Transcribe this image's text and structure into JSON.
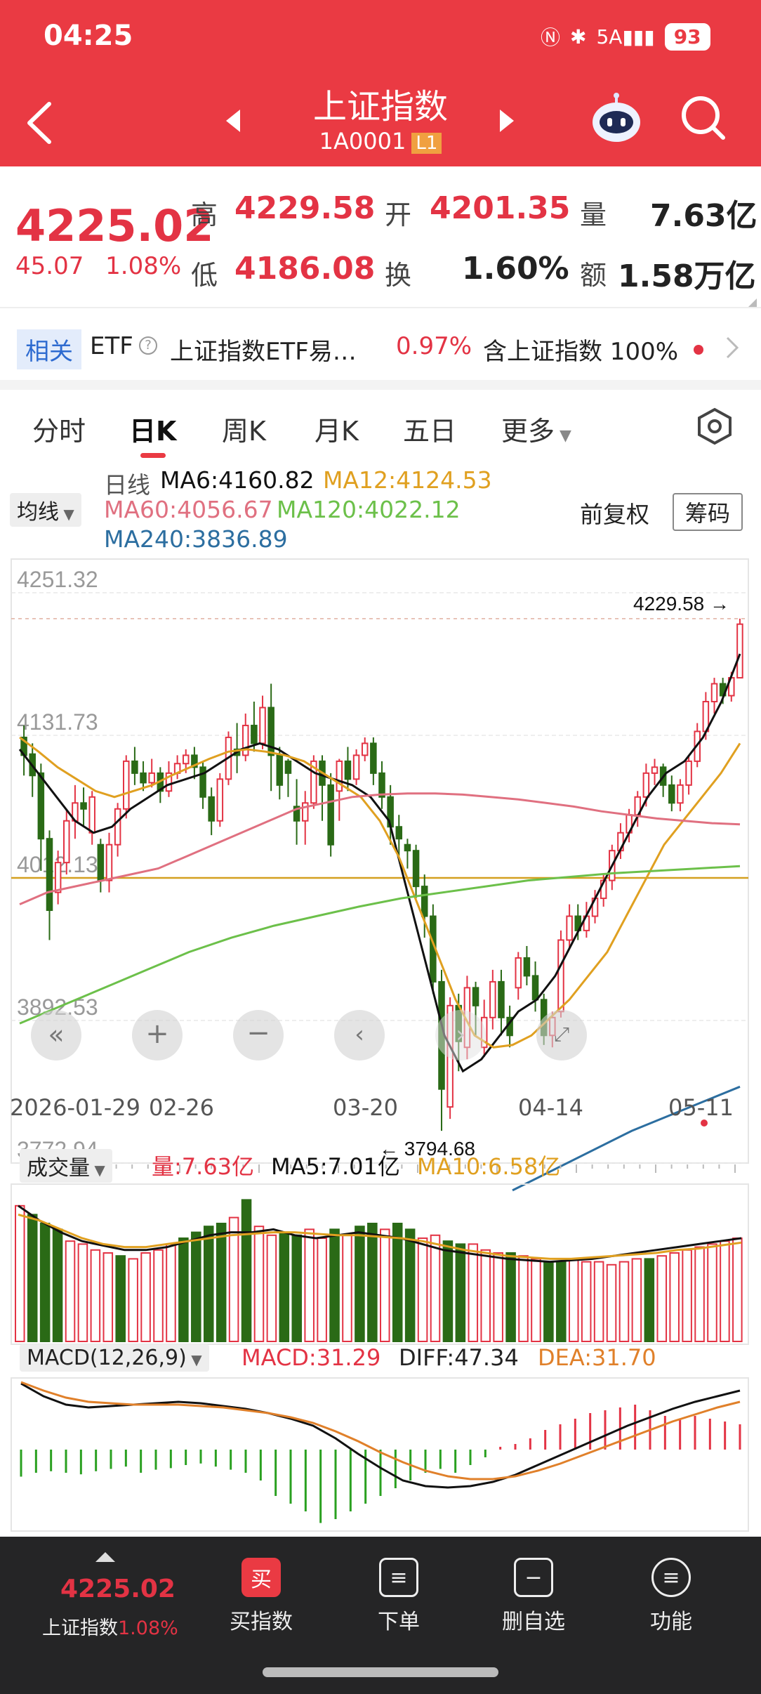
{
  "status": {
    "time": "04:25",
    "signal": "5A",
    "battery": "93"
  },
  "header": {
    "title": "上证指数",
    "code": "1A0001",
    "level": "L1"
  },
  "quote": {
    "price": "4225.02",
    "change": "45.07",
    "change_pct": "1.08%",
    "high_label": "高",
    "high": "4229.58",
    "open_label": "开",
    "open": "4201.35",
    "volume_label": "量",
    "volume": "7.63亿",
    "low_label": "低",
    "low": "4186.08",
    "turnover_label": "换",
    "turnover": "1.60%",
    "amount_label": "额",
    "amount": "1.58万亿"
  },
  "etf": {
    "tag": "相关",
    "label": "ETF",
    "name": "上证指数ETF易…",
    "pct": "0.97%",
    "holding": "含上证指数 100%"
  },
  "tabs": [
    "分时",
    "日K",
    "周K",
    "月K",
    "五日",
    "更多"
  ],
  "kline": {
    "ma_select": "均线",
    "period": "日线",
    "ma6": "MA6:4160.82",
    "ma12": "MA12:4124.53",
    "ma60": "MA60:4056.67",
    "ma120": "MA120:4022.12",
    "ma240": "MA240:3836.89",
    "adjust": "前复权",
    "chips": "筹码",
    "high_marker": "4229.58",
    "low_marker": "3794.68",
    "dates": [
      "2026-01-29",
      "02-26",
      "03-20",
      "04-14",
      "05-11"
    ],
    "colors": {
      "up": "#e33344",
      "down": "#2a6a16",
      "ma6": "#111111",
      "ma12": "#e0a020",
      "ma60": "#e07080",
      "ma120": "#6cc04a",
      "ma240": "#2c6ea0"
    }
  },
  "volume": {
    "select": "成交量",
    "vol": "量:7.63亿",
    "ma5": "MA5:7.01亿",
    "ma10": "MA10:6.58亿"
  },
  "macd": {
    "select": "MACD(12,26,9)",
    "macd": "MACD:31.29",
    "diff": "DIFF:47.34",
    "dea": "DEA:31.70"
  },
  "chart_data": {
    "type": "candlestick",
    "title": "上证指数 日K",
    "y_ticks": [
      4251.32,
      4131.73,
      4012.13,
      3892.53,
      3772.94
    ],
    "x_ticks": [
      "2026-01-29",
      "02-26",
      "03-20",
      "04-14",
      "05-11"
    ],
    "ylim": [
      3772.94,
      4251.32
    ],
    "candles": [
      [
        4130,
        4115,
        4140,
        4098
      ],
      [
        4116,
        4098,
        4125,
        4080
      ],
      [
        4100,
        4045,
        4108,
        4018
      ],
      [
        4045,
        3985,
        4052,
        3960
      ],
      [
        4000,
        4025,
        4035,
        3990
      ],
      [
        4025,
        4060,
        4070,
        4015
      ],
      [
        4060,
        4075,
        4090,
        4045
      ],
      [
        4075,
        4070,
        4088,
        4055
      ],
      [
        4050,
        4080,
        4085,
        4040
      ],
      [
        4040,
        4010,
        4045,
        4000
      ],
      [
        4010,
        4040,
        4050,
        4000
      ],
      [
        4040,
        4070,
        4075,
        4030
      ],
      [
        4070,
        4110,
        4115,
        4062
      ],
      [
        4110,
        4100,
        4122,
        4090
      ],
      [
        4100,
        4092,
        4110,
        4085
      ],
      [
        4092,
        4100,
        4112,
        4088
      ],
      [
        4100,
        4085,
        4105,
        4075
      ],
      [
        4085,
        4100,
        4110,
        4080
      ],
      [
        4100,
        4108,
        4115,
        4095
      ],
      [
        4108,
        4115,
        4120,
        4100
      ],
      [
        4115,
        4105,
        4122,
        4095
      ],
      [
        4105,
        4080,
        4110,
        4070
      ],
      [
        4080,
        4060,
        4088,
        4048
      ],
      [
        4060,
        4095,
        4100,
        4055
      ],
      [
        4095,
        4130,
        4135,
        4090
      ],
      [
        4120,
        4115,
        4142,
        4100
      ],
      [
        4115,
        4140,
        4150,
        4110
      ],
      [
        4140,
        4125,
        4160,
        4118
      ],
      [
        4125,
        4155,
        4165,
        4120
      ],
      [
        4155,
        4115,
        4175,
        4085
      ],
      [
        4115,
        4090,
        4122,
        4078
      ],
      [
        4110,
        4100,
        4112,
        4080
      ],
      [
        4072,
        4060,
        4095,
        4040
      ],
      [
        4060,
        4075,
        4085,
        4040
      ],
      [
        4075,
        4110,
        4115,
        4070
      ],
      [
        4110,
        4090,
        4115,
        4060
      ],
      [
        4090,
        4040,
        4100,
        4030
      ],
      [
        4085,
        4110,
        4112,
        4060
      ],
      [
        4110,
        4095,
        4122,
        4085
      ],
      [
        4095,
        4115,
        4120,
        4090
      ],
      [
        4115,
        4125,
        4130,
        4110
      ],
      [
        4125,
        4100,
        4130,
        4090
      ],
      [
        4100,
        4080,
        4110,
        4070
      ],
      [
        4080,
        4055,
        4090,
        4040
      ],
      [
        4055,
        4045,
        4065,
        4030
      ],
      [
        4040,
        4035,
        4045,
        4020
      ],
      [
        4035,
        4005,
        4040,
        3995
      ],
      [
        4005,
        3980,
        4015,
        3962
      ],
      [
        3980,
        3925,
        3990,
        3915
      ],
      [
        3925,
        3835,
        3935,
        3800
      ],
      [
        3820,
        3905,
        3912,
        3810
      ],
      [
        3905,
        3875,
        3915,
        3850
      ],
      [
        3870,
        3920,
        3930,
        3860
      ],
      [
        3920,
        3905,
        3925,
        3880
      ],
      [
        3870,
        3895,
        3910,
        3862
      ],
      [
        3895,
        3925,
        3935,
        3885
      ],
      [
        3925,
        3895,
        3935,
        3880
      ],
      [
        3895,
        3880,
        3905,
        3870
      ],
      [
        3920,
        3945,
        3950,
        3910
      ],
      [
        3945,
        3930,
        3955,
        3922
      ],
      [
        3930,
        3910,
        3942,
        3900
      ],
      [
        3910,
        3880,
        3915,
        3872
      ],
      [
        3880,
        3895,
        3900,
        3870
      ],
      [
        3900,
        3960,
        3968,
        3895
      ],
      [
        3960,
        3980,
        3990,
        3952
      ],
      [
        3980,
        3968,
        3990,
        3960
      ],
      [
        3968,
        3980,
        3992,
        3962
      ],
      [
        3980,
        3995,
        4002,
        3974
      ],
      [
        3995,
        4010,
        4015,
        3988
      ],
      [
        4010,
        4035,
        4040,
        4002
      ],
      [
        4035,
        4050,
        4058,
        4028
      ],
      [
        4050,
        4065,
        4070,
        4042
      ],
      [
        4065,
        4080,
        4085,
        4055
      ],
      [
        4080,
        4100,
        4108,
        4072
      ],
      [
        4100,
        4105,
        4112,
        4090
      ],
      [
        4105,
        4090,
        4108,
        4080
      ],
      [
        4090,
        4075,
        4098,
        4068
      ],
      [
        4075,
        4090,
        4095,
        4068
      ],
      [
        4090,
        4110,
        4115,
        4082
      ],
      [
        4110,
        4135,
        4142,
        4105
      ],
      [
        4135,
        4160,
        4168,
        4128
      ],
      [
        4160,
        4175,
        4180,
        4150
      ],
      [
        4175,
        4165,
        4180,
        4158
      ],
      [
        4165,
        4180,
        4185,
        4160
      ],
      [
        4180,
        4225,
        4229.58,
        4186
      ]
    ],
    "volume_bars": [
      [
        1,
        0.92
      ],
      [
        0,
        0.86
      ],
      [
        0,
        0.8
      ],
      [
        0,
        0.76
      ],
      [
        1,
        0.68
      ],
      [
        1,
        0.66
      ],
      [
        1,
        0.62
      ],
      [
        1,
        0.6
      ],
      [
        0,
        0.58
      ],
      [
        1,
        0.56
      ],
      [
        1,
        0.6
      ],
      [
        1,
        0.62
      ],
      [
        1,
        0.66
      ],
      [
        0,
        0.7
      ],
      [
        0,
        0.74
      ],
      [
        0,
        0.78
      ],
      [
        0,
        0.8
      ],
      [
        1,
        0.84
      ],
      [
        0,
        0.96
      ],
      [
        1,
        0.78
      ],
      [
        1,
        0.72
      ],
      [
        0,
        0.74
      ],
      [
        0,
        0.72
      ],
      [
        1,
        0.76
      ],
      [
        1,
        0.7
      ],
      [
        0,
        0.76
      ],
      [
        1,
        0.72
      ],
      [
        0,
        0.78
      ],
      [
        0,
        0.8
      ],
      [
        1,
        0.76
      ],
      [
        0,
        0.8
      ],
      [
        0,
        0.76
      ],
      [
        1,
        0.7
      ],
      [
        1,
        0.72
      ],
      [
        0,
        0.68
      ],
      [
        0,
        0.66
      ],
      [
        1,
        0.66
      ],
      [
        1,
        0.62
      ],
      [
        1,
        0.6
      ],
      [
        0,
        0.6
      ],
      [
        1,
        0.58
      ],
      [
        1,
        0.56
      ],
      [
        0,
        0.54
      ],
      [
        0,
        0.54
      ],
      [
        1,
        0.56
      ],
      [
        1,
        0.54
      ],
      [
        1,
        0.54
      ],
      [
        1,
        0.52
      ],
      [
        1,
        0.54
      ],
      [
        1,
        0.56
      ],
      [
        0,
        0.56
      ],
      [
        1,
        0.58
      ],
      [
        1,
        0.6
      ],
      [
        1,
        0.62
      ],
      [
        1,
        0.64
      ],
      [
        1,
        0.66
      ],
      [
        1,
        0.68
      ],
      [
        1,
        0.7
      ]
    ],
    "macd_bars": [
      -0.35,
      -0.3,
      -0.28,
      -0.3,
      -0.32,
      -0.28,
      -0.25,
      -0.22,
      -0.3,
      -0.26,
      -0.24,
      -0.2,
      -0.18,
      -0.22,
      -0.26,
      -0.3,
      -0.4,
      -0.6,
      -0.7,
      -0.8,
      -0.95,
      -0.9,
      -0.8,
      -0.7,
      -0.6,
      -0.5,
      -0.4,
      -0.3,
      -0.25,
      -0.3,
      -0.2,
      -0.1,
      0.05,
      0.1,
      0.2,
      0.35,
      0.45,
      0.55,
      0.65,
      0.7,
      0.75,
      0.8,
      0.7,
      0.6,
      0.55,
      0.6,
      0.55,
      0.5,
      0.45
    ],
    "series": [
      {
        "name": "MA6",
        "points": [
          4120,
          4100,
          4080,
          4060,
          4050,
          4055,
          4070,
          4080,
          4090,
          4095,
          4100,
          4110,
          4120,
          4125,
          4120,
          4110,
          4100,
          4095,
          4090,
          4080,
          4060,
          4000,
          3940,
          3880,
          3850,
          3860,
          3880,
          3900,
          3910,
          3930,
          3960,
          3990,
          4020,
          4050,
          4080,
          4100,
          4110,
          4130,
          4160,
          4200
        ]
      },
      {
        "name": "MA12",
        "points": [
          4130,
          4118,
          4105,
          4095,
          4085,
          4080,
          4085,
          4090,
          4098,
          4105,
          4112,
          4118,
          4120,
          4118,
          4115,
          4110,
          4100,
          4090,
          4080,
          4060,
          4030,
          3990,
          3950,
          3910,
          3880,
          3870,
          3872,
          3880,
          3895,
          3910,
          3930,
          3950,
          3980,
          4010,
          4040,
          4060,
          4080,
          4100,
          4125
        ]
      },
      {
        "name": "MA60",
        "points": [
          3990,
          4000,
          4005,
          4010,
          4015,
          4020,
          4030,
          4040,
          4050,
          4060,
          4070,
          4075,
          4080,
          4082,
          4083,
          4083,
          4082,
          4080,
          4078,
          4075,
          4072,
          4068,
          4065,
          4062,
          4060,
          4058,
          4057
        ]
      },
      {
        "name": "MA120",
        "points": [
          3890,
          3905,
          3920,
          3935,
          3950,
          3962,
          3972,
          3980,
          3988,
          3995,
          4000,
          4005,
          4010,
          4013,
          4016,
          4018,
          4020,
          4022
        ]
      },
      {
        "name": "MA240",
        "points": [
          3750,
          3800,
          3837
        ]
      }
    ]
  }
}
